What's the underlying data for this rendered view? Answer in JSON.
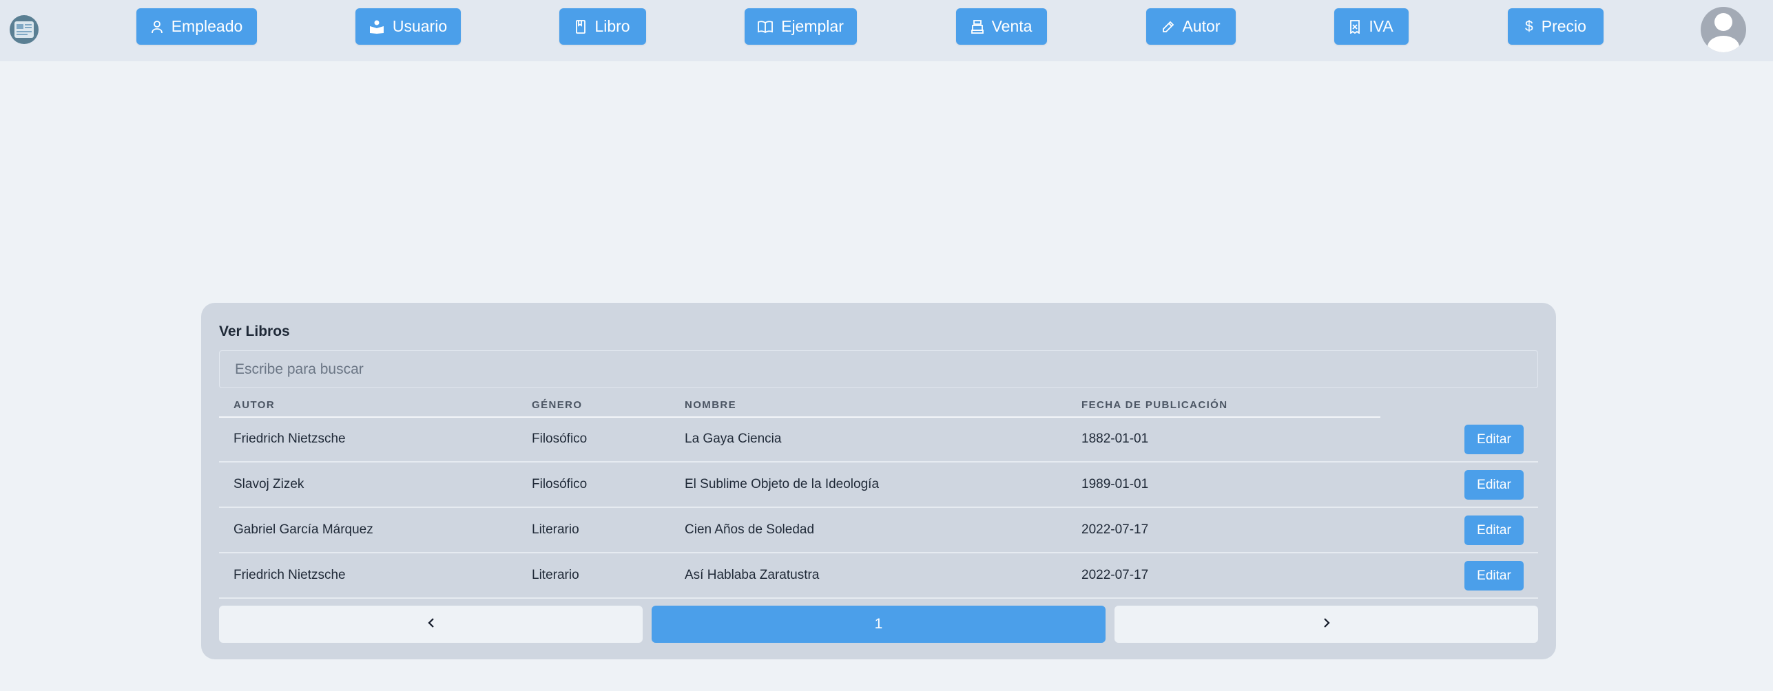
{
  "nav": {
    "buttons": [
      {
        "label": "Empleado",
        "icon": "user-icon"
      },
      {
        "label": "Usuario",
        "icon": "users-icon"
      },
      {
        "label": "Libro",
        "icon": "book-icon"
      },
      {
        "label": "Ejemplar",
        "icon": "book-open-icon"
      },
      {
        "label": "Venta",
        "icon": "cash-register-icon"
      },
      {
        "label": "Autor",
        "icon": "pencil-icon"
      },
      {
        "label": "IVA",
        "icon": "receipt-icon"
      },
      {
        "label": "Precio",
        "icon": "dollar-icon"
      }
    ],
    "logo_icon": "logo-icon",
    "avatar_icon": "user-avatar-icon"
  },
  "panel": {
    "title": "Ver Libros",
    "search_placeholder": "Escribe para buscar",
    "columns": [
      "AUTOR",
      "GÉNERO",
      "NOMBRE",
      "FECHA DE PUBLICACIÓN"
    ],
    "rows": [
      {
        "autor": "Friedrich Nietzsche",
        "genero": "Filosófico",
        "nombre": "La Gaya Ciencia",
        "fecha": "1882-01-01",
        "action": "Editar"
      },
      {
        "autor": "Slavoj Zizek",
        "genero": "Filosófico",
        "nombre": "El Sublime Objeto de la Ideología",
        "fecha": "1989-01-01",
        "action": "Editar"
      },
      {
        "autor": "Gabriel García Márquez",
        "genero": "Literario",
        "nombre": "Cien Años de Soledad",
        "fecha": "2022-07-17",
        "action": "Editar"
      },
      {
        "autor": "Friedrich Nietzsche",
        "genero": "Literario",
        "nombre": "Así Hablaba Zaratustra",
        "fecha": "2022-07-17",
        "action": "Editar"
      }
    ],
    "pagination": {
      "prev_icon": "chevron-left-icon",
      "current_page": "1",
      "next_icon": "chevron-right-icon"
    }
  },
  "colors": {
    "accent": "#4b9fea",
    "navbar": "#e2e8f0",
    "background": "#eef2f6",
    "card": "#cfd6e0"
  }
}
